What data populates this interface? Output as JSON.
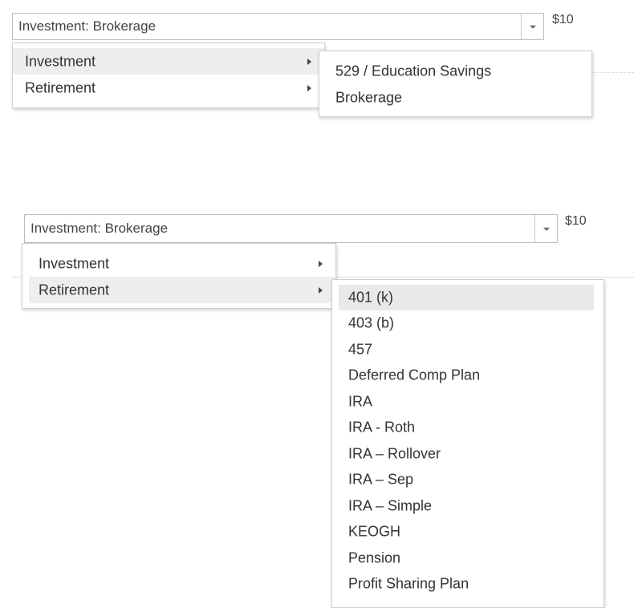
{
  "top_example": {
    "select_value": "Investment: Brokerage",
    "price": "$10",
    "menu": {
      "items": [
        {
          "label": "Investment"
        },
        {
          "label": "Retirement"
        }
      ]
    },
    "submenu": {
      "parent": "Investment",
      "items": [
        "529 / Education Savings",
        "Brokerage"
      ]
    }
  },
  "bottom_example": {
    "select_value": "Investment: Brokerage",
    "price": "$10",
    "menu": {
      "items": [
        {
          "label": "Investment"
        },
        {
          "label": "Retirement"
        }
      ]
    },
    "submenu": {
      "parent": "Retirement",
      "highlighted": "401 (k)",
      "items": [
        "401 (k)",
        "403 (b)",
        "457",
        "Deferred Comp Plan",
        "IRA",
        "IRA - Roth",
        "IRA – Rollover",
        "IRA – Sep",
        "IRA – Simple",
        "KEOGH",
        "Pension",
        "Profit Sharing Plan"
      ]
    },
    "colors": {
      "highlight": "#eeeeee",
      "border": "#cfcfcf",
      "text": "#333333"
    }
  }
}
